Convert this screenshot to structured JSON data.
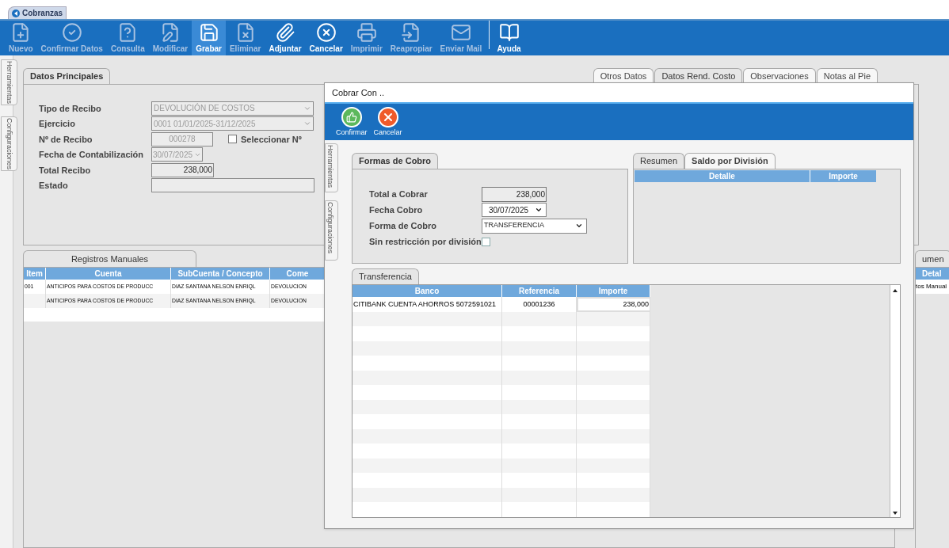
{
  "app_tab": {
    "title": "Cobranzas"
  },
  "toolbar": [
    {
      "label": "Nuevo",
      "disabled": true,
      "selected": false
    },
    {
      "label": "Confirmar Datos",
      "disabled": true,
      "selected": false
    },
    {
      "label": "Consulta",
      "disabled": true,
      "selected": false
    },
    {
      "label": "Modificar",
      "disabled": true,
      "selected": false
    },
    {
      "label": "Grabar",
      "disabled": false,
      "selected": true
    },
    {
      "label": "Eliminar",
      "disabled": true,
      "selected": false
    },
    {
      "label": "Adjuntar",
      "disabled": false,
      "selected": false
    },
    {
      "label": "Cancelar",
      "disabled": false,
      "selected": false
    },
    {
      "label": "Imprimir",
      "disabled": true,
      "selected": false
    },
    {
      "label": "Reapropiar",
      "disabled": true,
      "selected": false
    },
    {
      "label": "Enviar Mail",
      "disabled": true,
      "selected": false
    },
    {
      "label": "Ayuda",
      "disabled": false,
      "selected": false
    }
  ],
  "side_tabs": [
    "Herramientas",
    "Configuraciones"
  ],
  "main_form": {
    "tab": "Datos Principales",
    "fields": [
      {
        "label": "Tipo de Recibo",
        "kind": "select",
        "value": "DEVOLUCIÓN DE COSTOS",
        "disabled": true
      },
      {
        "label": "Ejercicio",
        "kind": "select",
        "value": "0001 01/01/2025-31/12/2025",
        "disabled": true
      },
      {
        "label": "Nº de Recibo",
        "kind": "code",
        "value": "000278",
        "disabled": true
      },
      {
        "label": "Fecha de Contabilización",
        "kind": "date",
        "value": "30/07/2025",
        "disabled": true
      },
      {
        "label": "Total Recibo",
        "kind": "amount",
        "value": "238,000",
        "disabled": false
      },
      {
        "label": "Estado",
        "kind": "text"
      }
    ],
    "checkbox": {
      "label": "Seleccionar Nº",
      "checked": false
    }
  },
  "right_tabs": [
    {
      "label": "Otros Datos",
      "selected": false
    },
    {
      "label": "Datos Rend. Costo",
      "selected": true
    },
    {
      "label": "Observaciones",
      "selected": false
    },
    {
      "label": "Notas al Pie",
      "selected": false
    }
  ],
  "manual_records": {
    "tab": "Registros Manuales",
    "columns": [
      "Item",
      "Cuenta",
      "SubCuenta / Concepto",
      "Come"
    ],
    "rows": [
      [
        "001",
        "ANTICIPOS PARA COSTOS DE PRODUCC",
        "DIAZ SANTANA NELSON ENRIQL",
        "DEVOLUCION"
      ],
      [
        "",
        "ANTICIPOS PARA COSTOS DE PRODUCC",
        "DIAZ SANTANA NELSON ENRIQL",
        "DEVOLUCION"
      ]
    ]
  },
  "side_panel": {
    "tab": "umen",
    "column": "Detal",
    "cell": "tos Manual"
  },
  "dialog": {
    "title": "Cobrar Con ..",
    "buttons": [
      "Confirmar",
      "Cancelar"
    ],
    "side_tabs": [
      "Herramientas",
      "Configuraciones"
    ],
    "form": {
      "tab": "Formas de Cobro",
      "fields": [
        {
          "label": "Total a Cobrar",
          "kind": "amount",
          "value": "238,000"
        },
        {
          "label": "Fecha Cobro",
          "kind": "date",
          "value": "30/07/2025"
        },
        {
          "label": "Forma de Cobro",
          "kind": "select",
          "value": "TRANSFERENCIA"
        },
        {
          "label": "Sin restricción por división",
          "kind": "checkbox",
          "checked": false
        }
      ]
    },
    "summary": {
      "tabs": [
        {
          "label": "Resumen",
          "selected": true
        },
        {
          "label": "Saldo por División",
          "selected": false
        }
      ],
      "columns": [
        "Detalle",
        "Importe"
      ]
    },
    "transfer": {
      "tab": "Transferencia",
      "columns": [
        "Banco",
        "Referencia",
        "Importe"
      ],
      "rows": [
        [
          "CITIBANK CUENTA AHORROS 5072591021",
          "00001236",
          "238,000"
        ]
      ]
    }
  }
}
